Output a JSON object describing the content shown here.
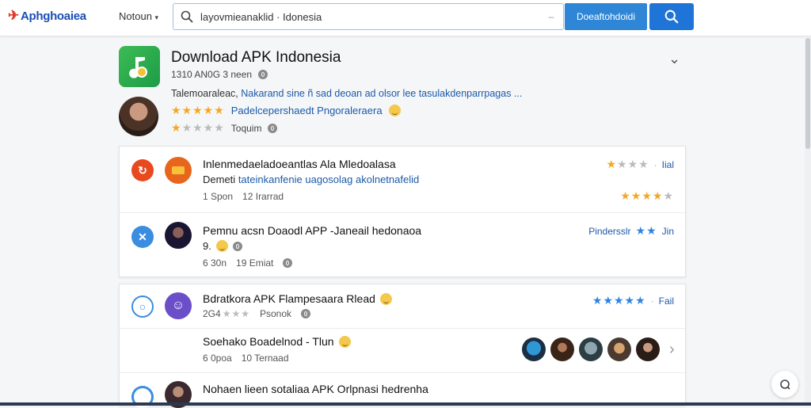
{
  "topbar": {
    "logo_text": "Aphghoaiea",
    "nav_select": "Notoun",
    "search_value": "layovmieanaklid · Idonesia",
    "download_button": "Doeaftohdoidi",
    "search_icon": "search-icon"
  },
  "app": {
    "title": "Download APK Indonesia",
    "meta": "1310 AN0G 3 neen",
    "description_dark": "Talemoaraleac,",
    "description_link": "Nakarand sine ñ sad deoan ad olsor lee tasulakdenparrpagas ...",
    "rating_label": "Padelcepershaedt Pngoraleraera",
    "rating_stars": 5,
    "secondary_stars": 1,
    "secondary_label": "Toquim"
  },
  "items": [
    {
      "title": "Inlenmedaeladoeantlas Ala Mledoalasa",
      "sub_dark": "Demeti",
      "sub_link": "tateinkanfenie uagosolag akolnetnafelid",
      "meta_a": "1 Spon",
      "meta_b": "12 Irarrad",
      "right_label": "Iial",
      "right_stars": 1.5
    },
    {
      "title": "Pemnu acsn Doaodl APP -Janeail hedonaoa",
      "sub_dark": "9.",
      "meta_a": "6 30n",
      "meta_b": "19 Emiat",
      "right_label": "Pindersslr",
      "right_suffix": "Jin"
    },
    {
      "title": "Bdratkora APK Flampesaara Rlead",
      "meta_a": "2G4",
      "meta_b": "Psonok",
      "right_label": "Fail",
      "right_stars": 5
    },
    {
      "title": "Soehako Boadelnod - Tlun",
      "meta_a": "6 0poa",
      "meta_b": "10 Ternaad"
    },
    {
      "title": "Nohaen lieen sotaliaa APK Orlpnasi hedrenha"
    }
  ],
  "colors": {
    "accent": "#1f74d8",
    "star": "#f5a623",
    "link": "#1c5aa8"
  }
}
